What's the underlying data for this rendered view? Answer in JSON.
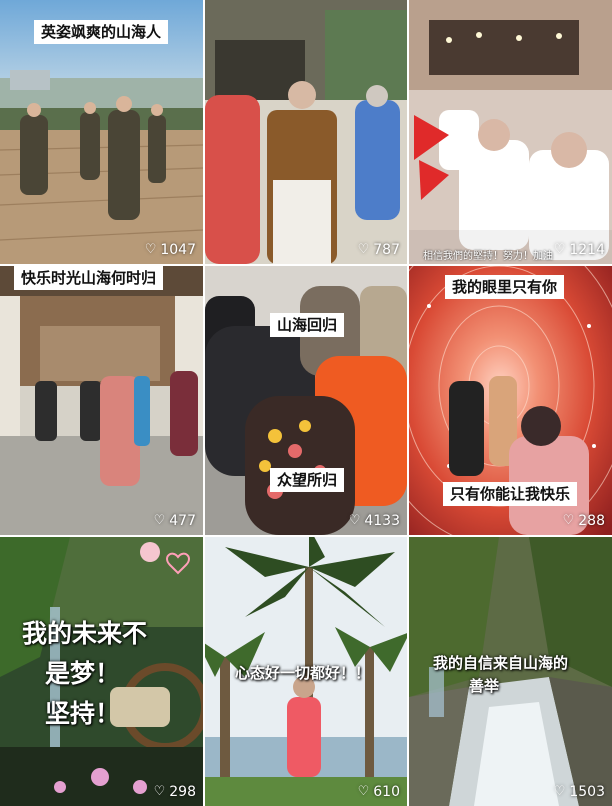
{
  "videos": [
    {
      "caption": "英姿飒爽的山海人",
      "likes": "1047"
    },
    {
      "caption": "",
      "likes": "787"
    },
    {
      "caption": "",
      "subtitle": "相信我們的堅持！努力！加油",
      "likes": "1214"
    },
    {
      "caption": "快乐时光山海何时归",
      "likes": "477"
    },
    {
      "caption": "山海回归",
      "caption2": "众望所归",
      "likes": "4133"
    },
    {
      "caption": "我的眼里只有你",
      "caption2": "只有你能让我快乐",
      "likes": "288"
    },
    {
      "caption_line1": "我的未来不",
      "caption_line2": "是梦！",
      "caption_line3": "坚持！",
      "likes": "298"
    },
    {
      "caption": "心态好一切都好！！",
      "likes": "610"
    },
    {
      "caption_line1": "我的自信来自山海的",
      "caption_line2": "善举",
      "likes": "1503"
    }
  ],
  "icons": {
    "like": "heart-outline-icon"
  }
}
